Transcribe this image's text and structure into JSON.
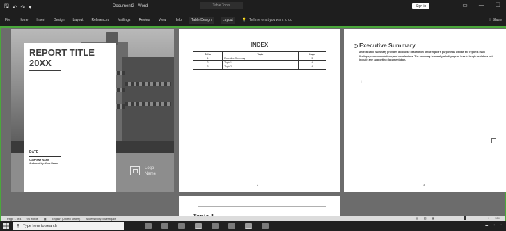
{
  "titlebar": {
    "qat": {
      "save_icon": "save-icon",
      "undo": "↶",
      "redo": "↷"
    },
    "document_title": "Document2 - Word",
    "context_group": "Table Tools",
    "sign_in": "Sign in"
  },
  "ribbon": {
    "tabs": [
      "File",
      "Home",
      "Insert",
      "Design",
      "Layout",
      "References",
      "Mailings",
      "Review",
      "View",
      "Help",
      "Table Design",
      "Layout"
    ],
    "tell_me": "Tell me what you want to do",
    "share": "Share"
  },
  "cover": {
    "title_line1": "REPORT TITLE",
    "title_line2": "20XX",
    "date": "DATE",
    "company_line1": "COMPANY NAME",
    "company_line2": "Authored by: Your Name",
    "logo_line1": "Logo",
    "logo_line2": "Name"
  },
  "index_page": {
    "title": "INDEX",
    "headers": [
      "S. No",
      "Topic",
      "Page"
    ],
    "rows": [
      [
        "1",
        "Executive Summary",
        "3"
      ],
      [
        "2",
        "Topic 1",
        "4"
      ],
      [
        "3",
        "Topic 2",
        "4"
      ]
    ],
    "page_number": "2"
  },
  "summary_page": {
    "title": "Executive Summary",
    "body": "An executive summary provides a concise description of the report's purpose as well as the report's main findings, recommendations, and conclusions. The summary is usually a half page or less in length and does not include any supporting documentation.",
    "page_number": "3"
  },
  "next_page": {
    "title": "Topic 1"
  },
  "statusbar": {
    "page": "Page 1 of 4",
    "words": "96 words",
    "language": "English (United States)",
    "accessibility": "Accessibility: Investigate",
    "zoom": "10%"
  },
  "taskbar": {
    "search_placeholder": "Type here to search"
  },
  "colors": {
    "accent_green": "#4aa83b",
    "dark_chrome": "#1e1e1e"
  }
}
